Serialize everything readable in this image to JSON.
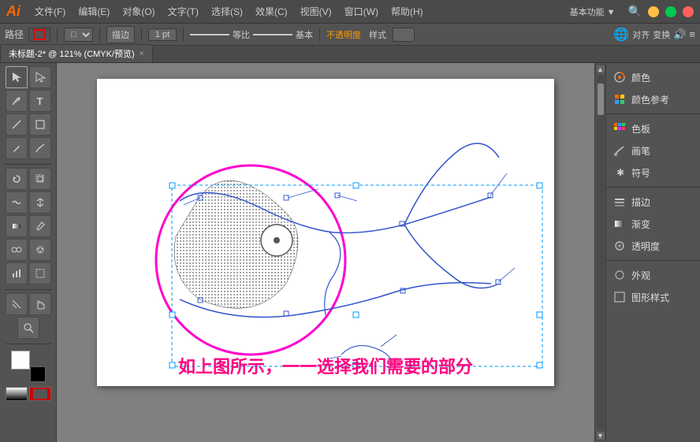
{
  "titlebar": {
    "logo": "Ai",
    "menus": [
      "文件(F)",
      "编辑(E)",
      "对象(O)",
      "文字(T)",
      "选择(S)",
      "效果(C)",
      "视图(V)",
      "窗口(W)",
      "帮助(H)"
    ],
    "workspace": "基本功能 ▼",
    "win_buttons": [
      "minimize",
      "maximize",
      "close"
    ]
  },
  "toolbar": {
    "label": "路径",
    "stroke_icon": "stroke-icon",
    "shape_selector": "矩形",
    "mode_selector": "描边",
    "weight": "1 pt",
    "line_style": "等比",
    "dash_style": "基本",
    "opacity_label": "不透明度",
    "style_label": "样式",
    "right_buttons": [
      "对齐",
      "变换"
    ]
  },
  "tabbar": {
    "active_tab": "未标题-2* @ 121% (CMYK/预览)",
    "close_label": "×"
  },
  "left_tools": [
    {
      "id": "select",
      "icon": "↖",
      "label": "选择工具"
    },
    {
      "id": "direct-select",
      "icon": "↗",
      "label": "直接选择"
    },
    {
      "id": "pen",
      "icon": "✒",
      "label": "钢笔工具"
    },
    {
      "id": "type",
      "icon": "T",
      "label": "文字工具"
    },
    {
      "id": "line",
      "icon": "/",
      "label": "直线工具"
    },
    {
      "id": "rect",
      "icon": "□",
      "label": "矩形工具"
    },
    {
      "id": "pencil",
      "icon": "✏",
      "label": "铅笔工具"
    },
    {
      "id": "brush",
      "icon": "🖌",
      "label": "画笔工具"
    },
    {
      "id": "rotate",
      "icon": "↻",
      "label": "旋转工具"
    },
    {
      "id": "scale",
      "icon": "⤡",
      "label": "缩放工具"
    },
    {
      "id": "warp",
      "icon": "≋",
      "label": "变形工具"
    },
    {
      "id": "gradient",
      "icon": "▣",
      "label": "渐变工具"
    },
    {
      "id": "eyedrop",
      "icon": "💉",
      "label": "吸管工具"
    },
    {
      "id": "measure",
      "icon": "📏",
      "label": "度量工具"
    },
    {
      "id": "symbol",
      "icon": "⊞",
      "label": "符号工具"
    },
    {
      "id": "column-chart",
      "icon": "📊",
      "label": "柱状图工具"
    },
    {
      "id": "artboard",
      "icon": "⬜",
      "label": "画板工具"
    },
    {
      "id": "slice",
      "icon": "✂",
      "label": "切片工具"
    },
    {
      "id": "hand",
      "icon": "✋",
      "label": "抓手工具"
    },
    {
      "id": "zoom",
      "icon": "🔍",
      "label": "缩放查看"
    }
  ],
  "right_panels": [
    {
      "id": "color",
      "icon": "🎨",
      "label": "颜色"
    },
    {
      "id": "color-ref",
      "icon": "🎨",
      "label": "颜色参考"
    },
    {
      "id": "swatch",
      "icon": "▦",
      "label": "色板"
    },
    {
      "id": "brush",
      "icon": "🖌",
      "label": "画笔"
    },
    {
      "id": "symbol",
      "icon": "✱",
      "label": "符号"
    },
    {
      "id": "stroke",
      "icon": "≡",
      "label": "描边"
    },
    {
      "id": "gradient",
      "icon": "⬜",
      "label": "渐变"
    },
    {
      "id": "opacity",
      "icon": "◎",
      "label": "透明度"
    },
    {
      "id": "appearance",
      "icon": "◎",
      "label": "外观"
    },
    {
      "id": "graphic-style",
      "icon": "▣",
      "label": "图形样式"
    }
  ],
  "canvas": {
    "zoom": "121%",
    "color_mode": "CMYK/预览",
    "caption": "如上图所示，一一选择我们需要的部分"
  },
  "colors": {
    "accent_pink": "#ff00aa",
    "accent_blue": "#3355ff",
    "selection_blue": "#0099ff",
    "bg_dark": "#535353",
    "toolbar_bg": "#535353",
    "panel_bg": "#535353"
  }
}
